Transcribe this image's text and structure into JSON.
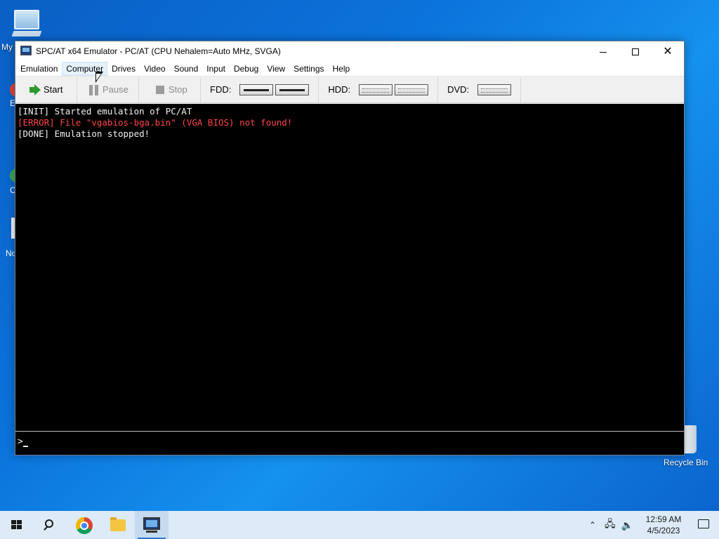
{
  "desktop": {
    "icons": {
      "my_computer": "My",
      "recycle_bin": "Recycle Bin",
      "partial_label_1": "E",
      "partial_label_2": "C",
      "partial_label_3": "No"
    }
  },
  "window": {
    "title": "SPC/AT x64 Emulator - PC/AT (CPU Nehalem=Auto MHz, SVGA)",
    "menu": [
      "Emulation",
      "Computer",
      "Drives",
      "Video",
      "Sound",
      "Input",
      "Debug",
      "View",
      "Settings",
      "Help"
    ],
    "hovered_menu": "Computer",
    "toolbar": {
      "start": "Start",
      "pause": "Pause",
      "stop": "Stop",
      "fdd_label": "FDD:",
      "hdd_label": "HDD:",
      "dvd_label": "DVD:"
    },
    "console": {
      "lines": [
        "[INIT] Started emulation of PC/AT",
        "[ERROR] File \"vgabios-bga.bin\" (VGA BIOS) not found!",
        "[DONE] Emulation stopped!"
      ],
      "error_color": "#ff4545",
      "prompt": ">"
    }
  },
  "taskbar": {
    "clock_time": "12:59 AM",
    "clock_date": "4/5/2023",
    "accent": "#2b79d8"
  },
  "icons": {
    "start": "windows-logo-icon",
    "search": "search-icon",
    "chrome": "chrome-icon",
    "explorer": "folder-icon",
    "emulator": "monitor-icon",
    "tray_chevron": "chevron-up-icon",
    "network": "network-icon",
    "volume": "speaker-icon",
    "notifications": "notification-icon"
  }
}
